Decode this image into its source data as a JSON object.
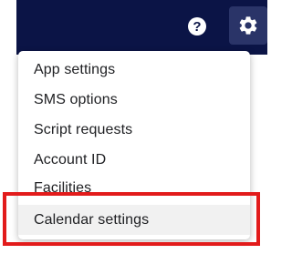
{
  "header": {
    "help_icon": "help-circle-icon",
    "help_glyph": "?",
    "settings_icon": "gear-icon",
    "background_color": "#0b1446"
  },
  "menu": {
    "items": [
      {
        "label": "App settings"
      },
      {
        "label": "SMS options"
      },
      {
        "label": "Script requests"
      },
      {
        "label": "Account ID"
      },
      {
        "label": "Facilities"
      },
      {
        "label": "Calendar settings",
        "hovered": true
      }
    ]
  },
  "annotation": {
    "highlight_color": "#e21b1b",
    "highlighted_item": "Calendar settings"
  }
}
